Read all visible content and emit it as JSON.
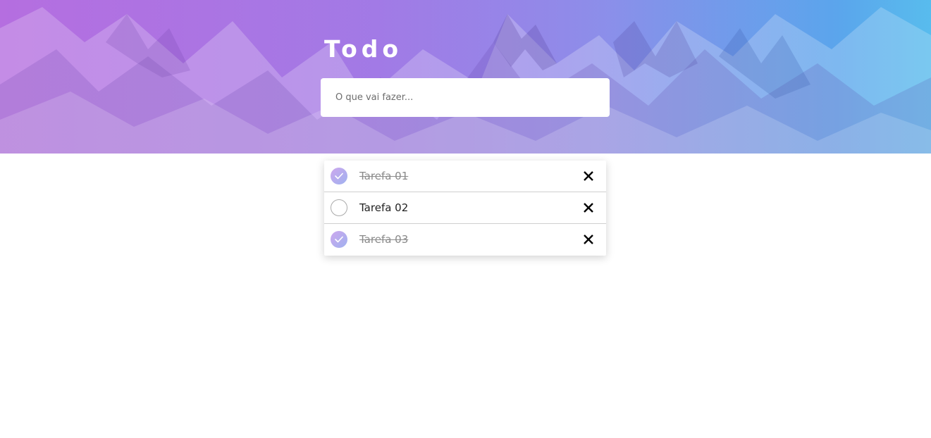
{
  "app": {
    "title": "Todo"
  },
  "input": {
    "placeholder": "O que vai fazer...",
    "value": ""
  },
  "todos": [
    {
      "label": "Tarefa 01",
      "completed": true
    },
    {
      "label": "Tarefa 02",
      "completed": false
    },
    {
      "label": "Tarefa 03",
      "completed": true
    }
  ],
  "icons": {
    "check": "check-icon",
    "remove": "close-icon"
  },
  "colors": {
    "gradient_start": "#b56ee0",
    "gradient_end": "#5bc2ee",
    "check_fill_start": "#cda7ee",
    "check_fill_end": "#9fb2ef"
  }
}
